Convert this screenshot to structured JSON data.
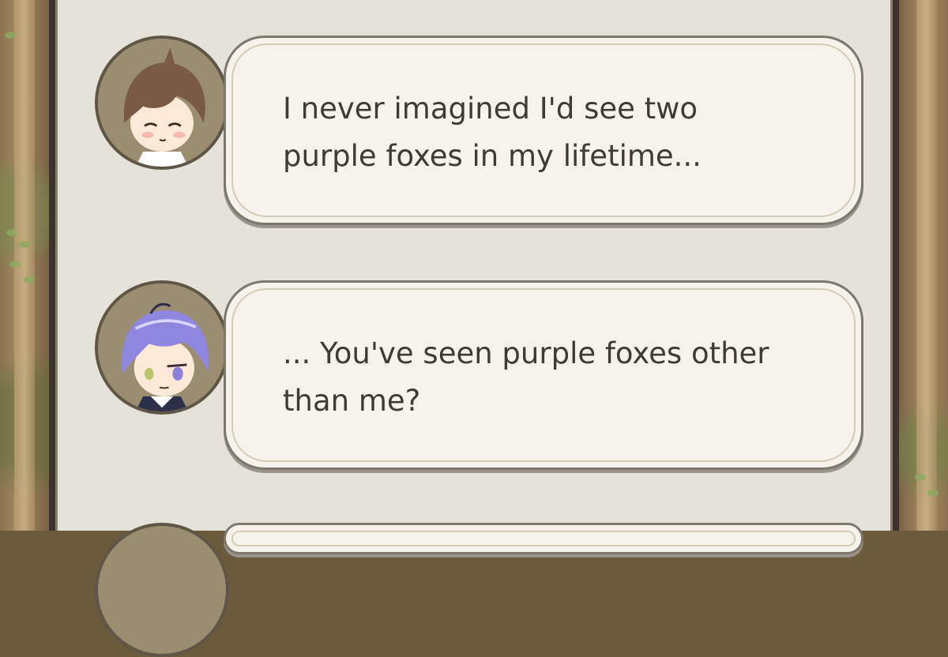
{
  "messages": [
    {
      "speaker_icon": "brown-haired-character-avatar",
      "text": "I never imagined I'd see two\npurple foxes in my lifetime..."
    },
    {
      "speaker_icon": "purple-haired-character-avatar",
      "text": "... You've seen purple foxes other\nthan me?"
    }
  ],
  "colors": {
    "panel_background": "#e5e2d9",
    "bubble_background": "#f6f3ed",
    "text": "#3f3a34",
    "frame": "#3a342c"
  }
}
